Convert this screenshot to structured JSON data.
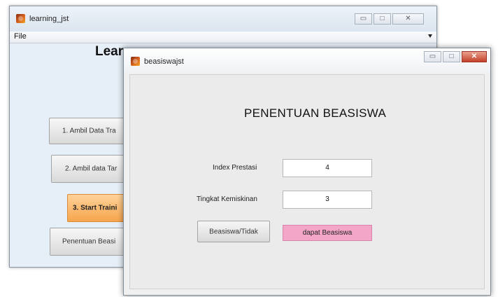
{
  "back_window": {
    "title": "learning_jst",
    "controls": {
      "minimize": "▭",
      "maximize": "□",
      "close": "✕"
    },
    "menu": {
      "file": "File"
    },
    "heading": "Lear",
    "buttons": [
      {
        "label": "1. Ambil Data Tra"
      },
      {
        "label": "2. Ambil data Tar"
      },
      {
        "label": "3. Start Traini"
      },
      {
        "label": "Penentuan Beasi"
      }
    ],
    "active_button_color": "#f6a54c"
  },
  "front_window": {
    "title": "beasiswajst",
    "controls": {
      "minimize": "▭",
      "maximize": "□",
      "close": "✕"
    },
    "heading": "PENENTUAN BEASISWA",
    "fields": {
      "index_prestasi": {
        "label": "Index Prestasi",
        "value": "4"
      },
      "tingkat_kemiskinan": {
        "label": "Tingkat Kemiskinan",
        "value": "3"
      }
    },
    "action_button": "Beasiswa/Tidak",
    "result": {
      "text": "dapat Beasiswa",
      "color": "#f4a6c9"
    }
  }
}
